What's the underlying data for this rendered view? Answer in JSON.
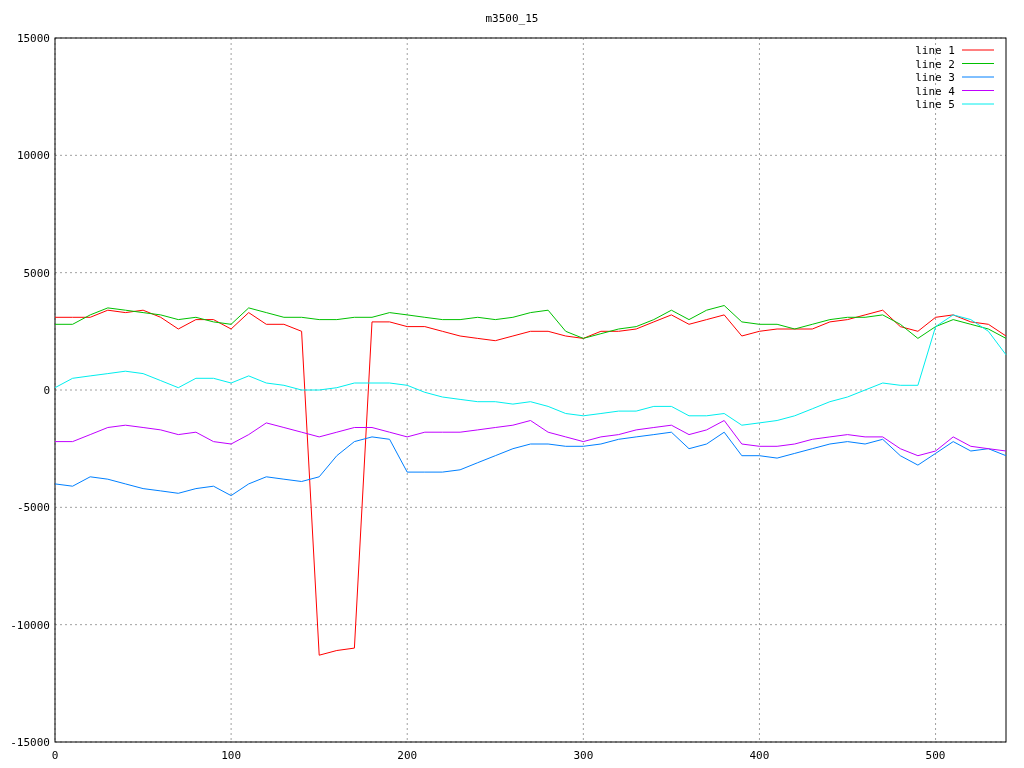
{
  "chart_data": {
    "type": "line",
    "title": "m3500_15",
    "x": [
      0,
      10,
      20,
      30,
      40,
      50,
      60,
      70,
      80,
      90,
      100,
      110,
      120,
      130,
      140,
      150,
      160,
      170,
      180,
      190,
      200,
      210,
      220,
      230,
      240,
      250,
      260,
      270,
      280,
      290,
      300,
      310,
      320,
      330,
      340,
      350,
      360,
      370,
      380,
      390,
      400,
      410,
      420,
      430,
      440,
      450,
      460,
      470,
      480,
      490,
      500,
      510,
      520,
      530,
      540
    ],
    "series": [
      {
        "name": "line 1",
        "color": "#ff0000",
        "values": [
          3100,
          3100,
          3100,
          3400,
          3300,
          3400,
          3100,
          2600,
          3000,
          3000,
          2600,
          3300,
          2800,
          2800,
          2500,
          -11300,
          -11100,
          -11000,
          2900,
          2900,
          2700,
          2700,
          2500,
          2300,
          2200,
          2100,
          2300,
          2500,
          2500,
          2300,
          2200,
          2500,
          2500,
          2600,
          2900,
          3200,
          2800,
          3000,
          3200,
          2300,
          2500,
          2600,
          2600,
          2600,
          2900,
          3000,
          3200,
          3400,
          2700,
          2500,
          3100,
          3200,
          2900,
          2800,
          2300
        ]
      },
      {
        "name": "line 2",
        "color": "#00c000",
        "values": [
          2800,
          2800,
          3200,
          3500,
          3400,
          3300,
          3200,
          3000,
          3100,
          2900,
          2800,
          3500,
          3300,
          3100,
          3100,
          3000,
          3000,
          3100,
          3100,
          3300,
          3200,
          3100,
          3000,
          3000,
          3100,
          3000,
          3100,
          3300,
          3400,
          2500,
          2200,
          2400,
          2600,
          2700,
          3000,
          3400,
          3000,
          3400,
          3600,
          2900,
          2800,
          2800,
          2600,
          2800,
          3000,
          3100,
          3100,
          3200,
          2800,
          2200,
          2700,
          3000,
          2800,
          2600,
          2200
        ]
      },
      {
        "name": "line 3",
        "color": "#0080ff",
        "values": [
          -4000,
          -4100,
          -3700,
          -3800,
          -4000,
          -4200,
          -4300,
          -4400,
          -4200,
          -4100,
          -4500,
          -4000,
          -3700,
          -3800,
          -3900,
          -3700,
          -2800,
          -2200,
          -2000,
          -2100,
          -3500,
          -3500,
          -3500,
          -3400,
          -3100,
          -2800,
          -2500,
          -2300,
          -2300,
          -2400,
          -2400,
          -2300,
          -2100,
          -2000,
          -1900,
          -1800,
          -2500,
          -2300,
          -1800,
          -2800,
          -2800,
          -2900,
          -2700,
          -2500,
          -2300,
          -2200,
          -2300,
          -2100,
          -2800,
          -3200,
          -2700,
          -2200,
          -2600,
          -2500,
          -2800
        ]
      },
      {
        "name": "line 4",
        "color": "#c000ff",
        "values": [
          -2200,
          -2200,
          -1900,
          -1600,
          -1500,
          -1600,
          -1700,
          -1900,
          -1800,
          -2200,
          -2300,
          -1900,
          -1400,
          -1600,
          -1800,
          -2000,
          -1800,
          -1600,
          -1600,
          -1800,
          -2000,
          -1800,
          -1800,
          -1800,
          -1700,
          -1600,
          -1500,
          -1300,
          -1800,
          -2000,
          -2200,
          -2000,
          -1900,
          -1700,
          -1600,
          -1500,
          -1900,
          -1700,
          -1300,
          -2300,
          -2400,
          -2400,
          -2300,
          -2100,
          -2000,
          -1900,
          -2000,
          -2000,
          -2500,
          -2800,
          -2600,
          -2000,
          -2400,
          -2500,
          -2600
        ]
      },
      {
        "name": "line 5",
        "color": "#00eeee",
        "values": [
          100,
          500,
          600,
          700,
          800,
          700,
          400,
          100,
          500,
          500,
          300,
          600,
          300,
          200,
          0,
          0,
          100,
          300,
          300,
          300,
          200,
          -100,
          -300,
          -400,
          -500,
          -500,
          -600,
          -500,
          -700,
          -1000,
          -1100,
          -1000,
          -900,
          -900,
          -700,
          -700,
          -1100,
          -1100,
          -1000,
          -1500,
          -1400,
          -1300,
          -1100,
          -800,
          -500,
          -300,
          0,
          300,
          200,
          200,
          2700,
          3200,
          3000,
          2500,
          1500
        ]
      }
    ],
    "xlim": [
      0,
      540
    ],
    "ylim": [
      -15000,
      15000
    ],
    "xticks": [
      0,
      100,
      200,
      300,
      400,
      500
    ],
    "yticks": [
      -15000,
      -10000,
      -5000,
      0,
      5000,
      10000,
      15000
    ],
    "grid": true,
    "legend": true
  }
}
